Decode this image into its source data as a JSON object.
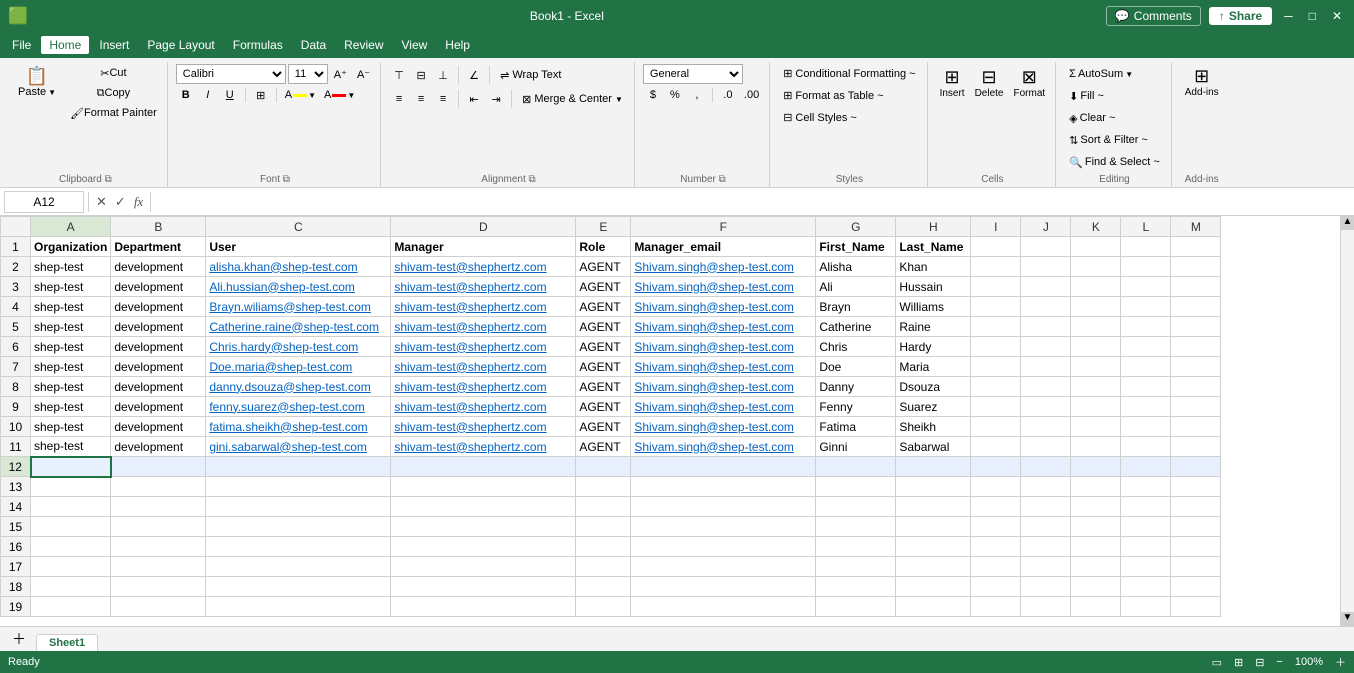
{
  "titlebar": {
    "filename": "Book1 - Excel",
    "comments_label": "Comments",
    "share_label": "Share"
  },
  "menubar": {
    "items": [
      "File",
      "Home",
      "Insert",
      "Page Layout",
      "Formulas",
      "Data",
      "Review",
      "View",
      "Help"
    ]
  },
  "ribbon": {
    "groups": {
      "clipboard": {
        "label": "Clipboard",
        "paste_label": "Paste",
        "cut_label": "Cut",
        "copy_label": "Copy",
        "format_painter_label": "Format Painter"
      },
      "font": {
        "label": "Font",
        "font_name": "Calibri",
        "font_size": "11",
        "bold_label": "B",
        "italic_label": "I",
        "underline_label": "U",
        "border_label": "⊞",
        "fill_color_label": "A",
        "font_color_label": "A",
        "fill_color": "#FFFF00",
        "font_color": "#FF0000"
      },
      "alignment": {
        "label": "Alignment",
        "wrap_text": "Wrap Text",
        "merge_center": "Merge & Center"
      },
      "number": {
        "label": "Number",
        "format": "General",
        "currency_label": "$",
        "percent_label": "%",
        "comma_label": ","
      },
      "styles": {
        "label": "Styles",
        "conditional_label": "Conditional Formatting ~",
        "format_table_label": "Format as Table ~",
        "cell_styles_label": "Cell Styles ~"
      },
      "cells": {
        "label": "Cells",
        "insert_label": "Insert",
        "delete_label": "Delete",
        "format_label": "Format"
      },
      "editing": {
        "label": "Editing",
        "autosum_label": "AutoSum",
        "fill_label": "Fill ~",
        "clear_label": "Clear ~",
        "sort_filter_label": "Sort & Filter ~",
        "find_select_label": "Find & Select ~"
      },
      "addins": {
        "label": "Add-ins",
        "addins_label": "Add-ins"
      }
    }
  },
  "formulabar": {
    "cell_ref": "A12",
    "formula_value": ""
  },
  "spreadsheet": {
    "columns": [
      "A",
      "B",
      "C",
      "D",
      "E",
      "F",
      "G",
      "H",
      "I",
      "J",
      "K",
      "L",
      "M"
    ],
    "headers": [
      "Organization",
      "Department",
      "User",
      "Manager",
      "Role",
      "Manager_email",
      "First_Name",
      "Last_Name"
    ],
    "rows": [
      {
        "row_num": 2,
        "cells": [
          "shep-test",
          "development",
          "alisha.khan@shep-test.com",
          "shivam-test@shephertz.com",
          "AGENT",
          "Shivam.singh@shep-test.com",
          "Alisha",
          "Khan"
        ]
      },
      {
        "row_num": 3,
        "cells": [
          "shep-test",
          "development",
          "Ali.hussian@shep-test.com",
          "shivam-test@shephertz.com",
          "AGENT",
          "Shivam.singh@shep-test.com",
          "Ali",
          "Hussain"
        ]
      },
      {
        "row_num": 4,
        "cells": [
          "shep-test",
          "development",
          "Brayn.wiliams@shep-test.com",
          "shivam-test@shephertz.com",
          "AGENT",
          "Shivam.singh@shep-test.com",
          "Brayn",
          "Williams"
        ]
      },
      {
        "row_num": 5,
        "cells": [
          "shep-test",
          "development",
          "Catherine.raine@shep-test.com",
          "shivam-test@shephertz.com",
          "AGENT",
          "Shivam.singh@shep-test.com",
          "Catherine",
          "Raine"
        ]
      },
      {
        "row_num": 6,
        "cells": [
          "shep-test",
          "development",
          "Chris.hardy@shep-test.com",
          "shivam-test@shephertz.com",
          "AGENT",
          "Shivam.singh@shep-test.com",
          "Chris",
          "Hardy"
        ]
      },
      {
        "row_num": 7,
        "cells": [
          "shep-test",
          "development",
          "Doe.maria@shep-test.com",
          "shivam-test@shephertz.com",
          "AGENT",
          "Shivam.singh@shep-test.com",
          "Doe",
          "Maria"
        ]
      },
      {
        "row_num": 8,
        "cells": [
          "shep-test",
          "development",
          "danny.dsouza@shep-test.com",
          "shivam-test@shephertz.com",
          "AGENT",
          "Shivam.singh@shep-test.com",
          "Danny",
          "Dsouza"
        ]
      },
      {
        "row_num": 9,
        "cells": [
          "shep-test",
          "development",
          "fenny.suarez@shep-test.com",
          "shivam-test@shephertz.com",
          "AGENT",
          "Shivam.singh@shep-test.com",
          "Fenny",
          "Suarez"
        ]
      },
      {
        "row_num": 10,
        "cells": [
          "shep-test",
          "development",
          "fatima.sheikh@shep-test.com",
          "shivam-test@shephertz.com",
          "AGENT",
          "Shivam.singh@shep-test.com",
          "Fatima",
          "Sheikh"
        ]
      },
      {
        "row_num": 11,
        "cells": [
          "shep-test",
          "development",
          "gini.sabarwal@shep-test.com",
          "shivam-test@shephertz.com",
          "AGENT",
          "Shivam.singh@shep-test.com",
          "Ginni",
          "Sabarwal"
        ]
      }
    ],
    "empty_rows": [
      12,
      13,
      14,
      15,
      16,
      17,
      18,
      19
    ],
    "selected_cell": "A12",
    "selected_row": 12
  },
  "sheet_tabs": {
    "sheets": [
      "Sheet1"
    ],
    "active": "Sheet1"
  },
  "status_bar": {
    "left": "Ready",
    "right_items": [
      "📊",
      "🔢",
      "🔲"
    ]
  }
}
